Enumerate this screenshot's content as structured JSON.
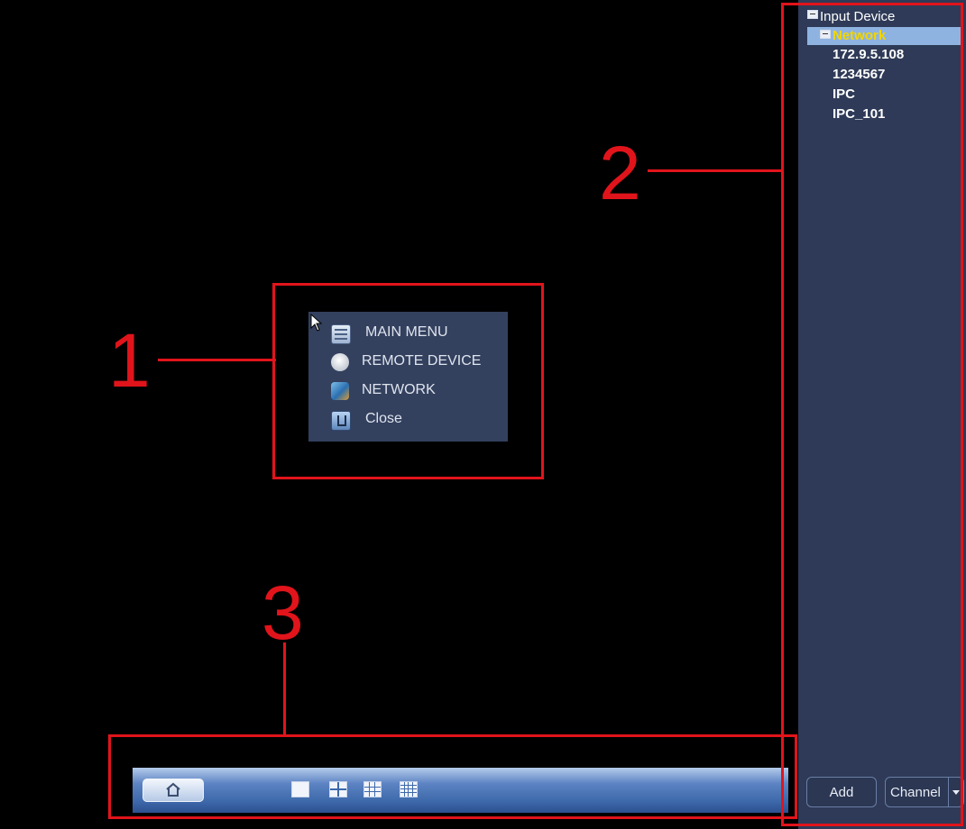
{
  "right_panel": {
    "tree": {
      "root": "Input Device",
      "group": "Network",
      "items": [
        "172.9.5.108",
        "1234567",
        "IPC",
        "IPC_101"
      ]
    },
    "add_label": "Add",
    "channel_label": "Channel"
  },
  "context_menu": {
    "items": [
      {
        "label": "MAIN MENU",
        "icon": "main-menu-icon"
      },
      {
        "label": "REMOTE DEVICE",
        "icon": "remote-device-icon"
      },
      {
        "label": "NETWORK",
        "icon": "network-icon"
      },
      {
        "label": "Close",
        "icon": "close-icon"
      }
    ]
  },
  "taskbar": {
    "icons": [
      "home-icon",
      "layout-1-icon",
      "layout-4-icon",
      "layout-9-icon",
      "layout-16-icon"
    ]
  },
  "annotations": {
    "labels": [
      "1",
      "2",
      "3"
    ],
    "color": "#e1141b"
  },
  "colors": {
    "background": "#000000",
    "panel": "#2e3a57",
    "menu": "#33405e",
    "selection": "#8fb3e0",
    "selected_text": "#f2d600"
  }
}
